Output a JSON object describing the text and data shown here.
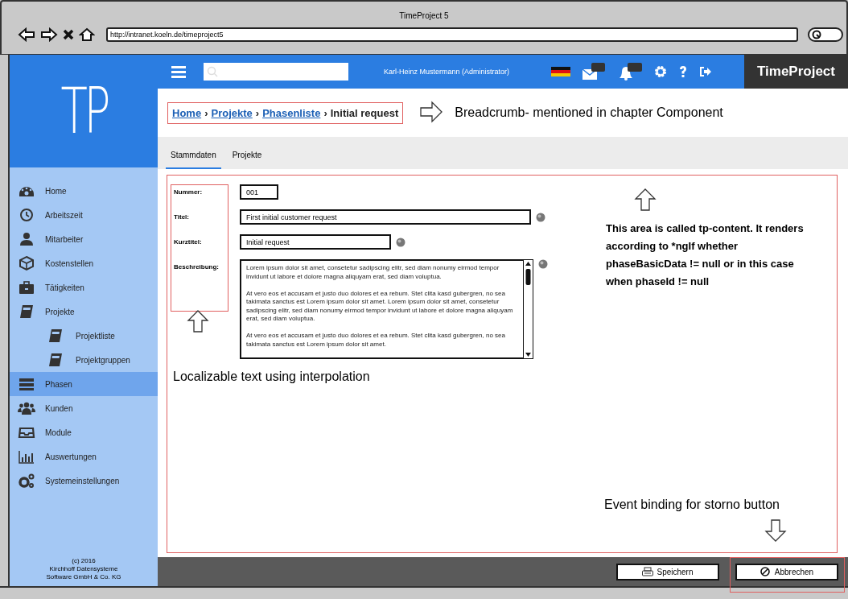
{
  "browser": {
    "title": "TimeProject 5",
    "url": "http://intranet.koeln.de/timeproject5"
  },
  "header": {
    "user": "Karl-Heinz Mustermann (Administrator)",
    "brand": "TimeProject"
  },
  "logo": "TP",
  "sidebar": {
    "items": [
      {
        "label": "Home",
        "selected": false
      },
      {
        "label": "Arbeitszeit",
        "selected": false
      },
      {
        "label": "Mitarbeiter",
        "selected": false
      },
      {
        "label": "Kostenstellen",
        "selected": false
      },
      {
        "label": "Tätigkeiten",
        "selected": false
      },
      {
        "label": "Projekte",
        "selected": false,
        "children": [
          {
            "label": "Projektliste",
            "selected": false
          },
          {
            "label": "Projektgruppen",
            "selected": false
          }
        ]
      },
      {
        "label": "Phasen",
        "selected": true
      },
      {
        "label": "Kunden",
        "selected": false
      },
      {
        "label": "Module",
        "selected": false
      },
      {
        "label": "Auswertungen",
        "selected": false
      },
      {
        "label": "Systemeinstellungen",
        "selected": false
      }
    ],
    "footer": [
      "(c) 2016",
      "Kirchhoff Datensysteme",
      "Software GmbH & Co. KG"
    ]
  },
  "breadcrumb": {
    "separator": "›",
    "items": [
      {
        "label": "Home",
        "link": true
      },
      {
        "label": "Projekte",
        "link": true
      },
      {
        "label": "Phasenliste",
        "link": true
      },
      {
        "label": "Initial request",
        "link": false
      }
    ]
  },
  "tabs": [
    {
      "label": "Stammdaten",
      "selected": true
    },
    {
      "label": "Projekte",
      "selected": false
    }
  ],
  "form": {
    "fields": [
      {
        "kind": "short",
        "label": "Nummer:",
        "value": "001",
        "translatable": false
      },
      {
        "kind": "long",
        "label": "Titel:",
        "value": "First initial customer request",
        "translatable": true
      },
      {
        "kind": "medium",
        "label": "Kurztitel:",
        "value": "Initial request",
        "translatable": true
      },
      {
        "kind": "textarea",
        "label": "Beschreibung:",
        "translatable": true,
        "paragraphs": [
          "Lorem ipsum dolor sit amet, consetetur sadipscing elitr, sed diam nonumy eirmod tempor invidunt ut labore et dolore magna aliquyam erat, sed diam voluptua.",
          "At vero eos et accusam et justo duo dolores et ea rebum. Stet clita kasd gubergren, no sea takimata sanctus est Lorem ipsum dolor sit amet. Lorem ipsum dolor sit amet, consetetur sadipscing elitr, sed diam nonumy eirmod tempor invidunt ut labore et dolore magna aliquyam erat, sed diam voluptua.",
          "At vero eos et accusam et justo duo dolores et ea rebum. Stet clita kasd gubergren, no sea takimata sanctus est Lorem ipsum dolor sit amet."
        ]
      }
    ]
  },
  "buttons": [
    {
      "label": "Speichern"
    },
    {
      "label": "Abbrechen"
    }
  ],
  "annotations": {
    "breadcrumb": "Breadcrumb- mentioned in chapter Component",
    "content": "This area is called tp-content. It renders according to *ngIf whether phaseBasicData != null or in this case when phaseId != null",
    "labels": "Localizable text using interpolation",
    "button": "Event binding for storno button"
  }
}
